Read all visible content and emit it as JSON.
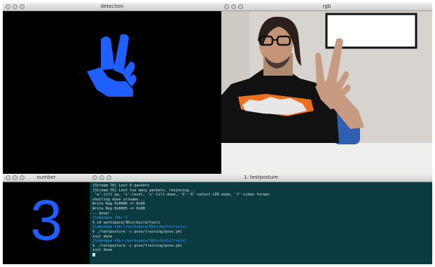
{
  "windows": {
    "detection": {
      "title": "detection"
    },
    "rgb": {
      "title": "rgb"
    },
    "number": {
      "title": "number",
      "value": "3"
    },
    "terminal": {
      "title": "1. testposture",
      "lines": [
        {
          "text": "[Stream 70] Lost 6 packets",
          "color": "white"
        },
        {
          "text": "[Stream 70] Lost too many packets, resyncing...",
          "color": "white"
        },
        {
          "text": " 'w'-tilt up, 's'-level, 'x'-tilt down, '0'-'6'-select LED mode, 'f'-video format",
          "color": "white"
        },
        {
          "text": "",
          "color": "white"
        },
        {
          "text": "shutting down streams...",
          "color": "white"
        },
        {
          "text": "Write Reg 0x0006 <= 0x00",
          "color": "white"
        },
        {
          "text": "Write Reg 0x0005 <= 0x00",
          "color": "white"
        },
        {
          "text": "-- done!",
          "color": "white"
        },
        {
          "text": "[lebengue fdk:~]",
          "color": "blue"
        },
        {
          "text": "% cd workspace/3Kin/build/tools",
          "color": "white"
        },
        {
          "text": "[lebengue fdk:~/workspace/3Kin/build/tools]",
          "color": "blue"
        },
        {
          "text": "% ./testposture -i pose/training/pose.yml",
          "color": "white"
        },
        {
          "text": "init done",
          "color": "white"
        },
        {
          "text": "[lebengue fdk:~/workspace/3Kin/build/tools]",
          "color": "blue"
        },
        {
          "text": "% ./testposture -i pose/training/pose.yml",
          "color": "white"
        },
        {
          "text": "init done",
          "color": "white"
        }
      ]
    }
  },
  "colors": {
    "hand_mask": "#1f5fff",
    "digit": "#1f5fff",
    "terminal_bg": "#0b3a40",
    "terminal_prompt": "#39a4ff"
  },
  "icons": [
    "window-close-icon",
    "window-minimize-icon",
    "window-zoom-icon"
  ]
}
